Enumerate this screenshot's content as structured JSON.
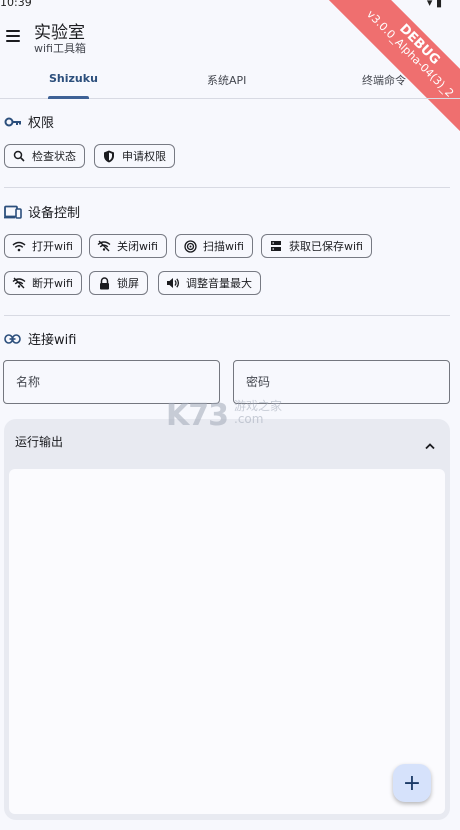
{
  "status_bar": {
    "time": "10:39"
  },
  "app_bar": {
    "title": "实验室",
    "subtitle": "wifi工具箱"
  },
  "debug_ribbon": {
    "label": "DEBUG",
    "version": "v3.0.0_Alpha-04(3)_2",
    "color": "#ef6f6f"
  },
  "tabs": [
    {
      "label": "Shizuku",
      "active": true
    },
    {
      "label": "系统API",
      "active": false
    },
    {
      "label": "终端命令",
      "active": false
    }
  ],
  "permission": {
    "title": "权限",
    "icon": "key-icon",
    "buttons": [
      {
        "label": "检查状态",
        "icon": "search-icon"
      },
      {
        "label": "申请权限",
        "icon": "shield-icon"
      }
    ]
  },
  "device_control": {
    "title": "设备控制",
    "icon": "devices-icon",
    "buttons": [
      {
        "label": "打开wifi",
        "icon": "wifi-icon"
      },
      {
        "label": "关闭wifi",
        "icon": "wifi-off-icon"
      },
      {
        "label": "扫描wifi",
        "icon": "radar-icon"
      },
      {
        "label": "获取已保存wifi",
        "icon": "storage-icon"
      },
      {
        "label": "断开wifi",
        "icon": "wifi-off-icon"
      },
      {
        "label": "锁屏",
        "icon": "lock-icon"
      },
      {
        "label": "调整音量最大",
        "icon": "volume-icon"
      }
    ]
  },
  "connect_wifi": {
    "title": "连接wifi",
    "icon": "link-icon",
    "name_placeholder": "名称",
    "password_placeholder": "密码"
  },
  "output": {
    "title": "运行输出",
    "content": ""
  },
  "fab": {
    "label": "+"
  },
  "watermark": {
    "logo": "K73",
    "text_line1": "游戏之家",
    "text_line2": ".com"
  },
  "colors": {
    "accent": "#3e6196",
    "background": "#f7f8fd",
    "card": "#e8eaf1",
    "fab": "#d6e2fb"
  }
}
